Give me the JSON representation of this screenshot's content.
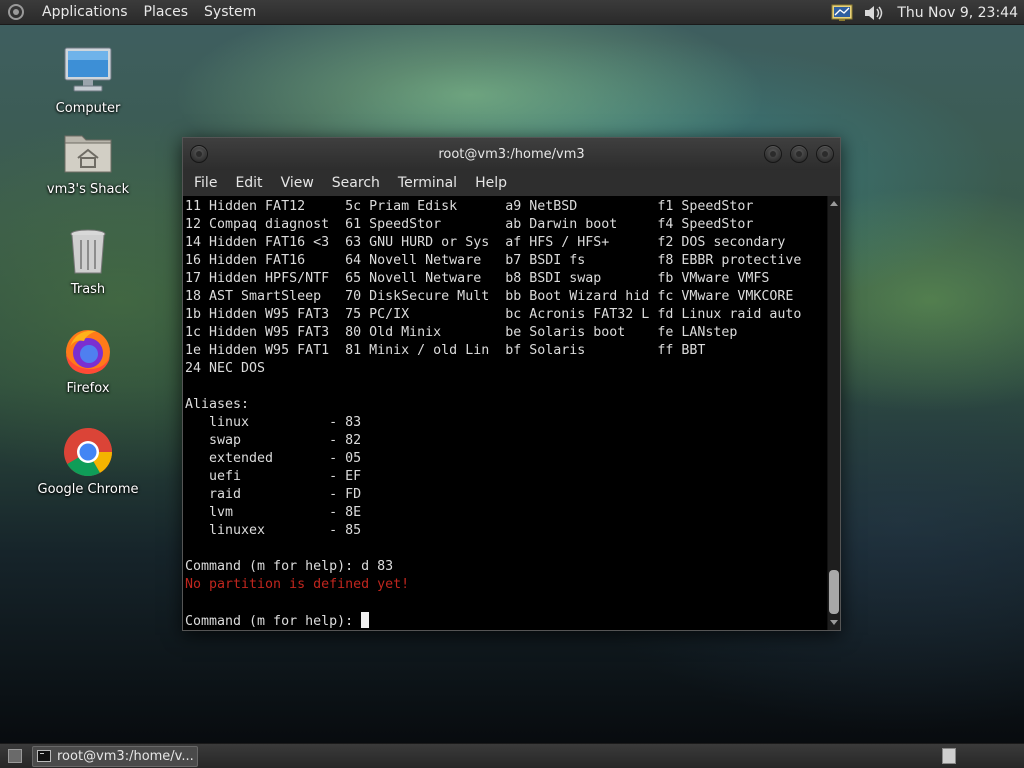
{
  "top_panel": {
    "menus": [
      "Applications",
      "Places",
      "System"
    ],
    "clock": "Thu Nov 9, 23:44"
  },
  "desktop_icons": {
    "computer": "Computer",
    "home": "vm3's Shack",
    "trash": "Trash",
    "firefox": "Firefox",
    "chrome": "Google Chrome"
  },
  "terminal": {
    "title": "root@vm3:/home/vm3",
    "menu": [
      "File",
      "Edit",
      "View",
      "Search",
      "Terminal",
      "Help"
    ],
    "lines": [
      "11 Hidden FAT12     5c Priam Edisk      a9 NetBSD          f1 SpeedStor",
      "12 Compaq diagnost  61 SpeedStor        ab Darwin boot     f4 SpeedStor",
      "14 Hidden FAT16 <3  63 GNU HURD or Sys  af HFS / HFS+      f2 DOS secondary",
      "16 Hidden FAT16     64 Novell Netware   b7 BSDI fs         f8 EBBR protective",
      "17 Hidden HPFS/NTF  65 Novell Netware   b8 BSDI swap       fb VMware VMFS",
      "18 AST SmartSleep   70 DiskSecure Mult  bb Boot Wizard hid fc VMware VMKCORE",
      "1b Hidden W95 FAT3  75 PC/IX            bc Acronis FAT32 L fd Linux raid auto",
      "1c Hidden W95 FAT3  80 Old Minix        be Solaris boot    fe LANstep",
      "1e Hidden W95 FAT1  81 Minix / old Lin  bf Solaris         ff BBT",
      "24 NEC DOS",
      "",
      "Aliases:",
      "   linux          - 83",
      "   swap           - 82",
      "   extended       - 05",
      "   uefi           - EF",
      "   raid           - FD",
      "   lvm            - 8E",
      "   linuxex        - 85",
      "",
      "Command (m for help): d 83"
    ],
    "error_line": "No partition is defined yet!",
    "prompt": "Command (m for help): "
  },
  "taskbar": {
    "task_label": "root@vm3:/home/v..."
  }
}
